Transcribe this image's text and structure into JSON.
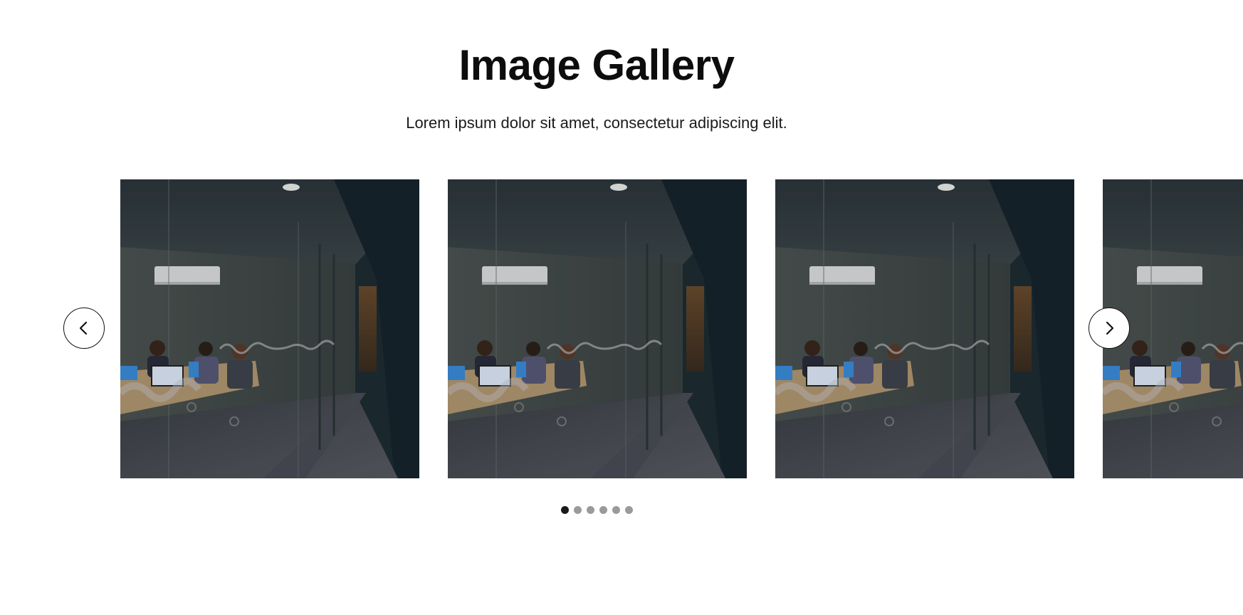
{
  "header": {
    "title": "Image Gallery",
    "subtitle": "Lorem ipsum dolor sit amet, consectetur adipiscing elit."
  },
  "carousel": {
    "slides": [
      {
        "subject": "office meeting room at night"
      },
      {
        "subject": "office meeting room at night"
      },
      {
        "subject": "office meeting room at night"
      },
      {
        "subject": "office meeting room at night"
      }
    ],
    "prev_icon": "chevron-left-icon",
    "next_icon": "chevron-right-icon",
    "dot_count": 6,
    "active_dot": 1
  },
  "colors": {
    "accent_dark": "#1a1a1a",
    "dot_inactive": "#9a9a9a",
    "background": "#ffffff"
  }
}
